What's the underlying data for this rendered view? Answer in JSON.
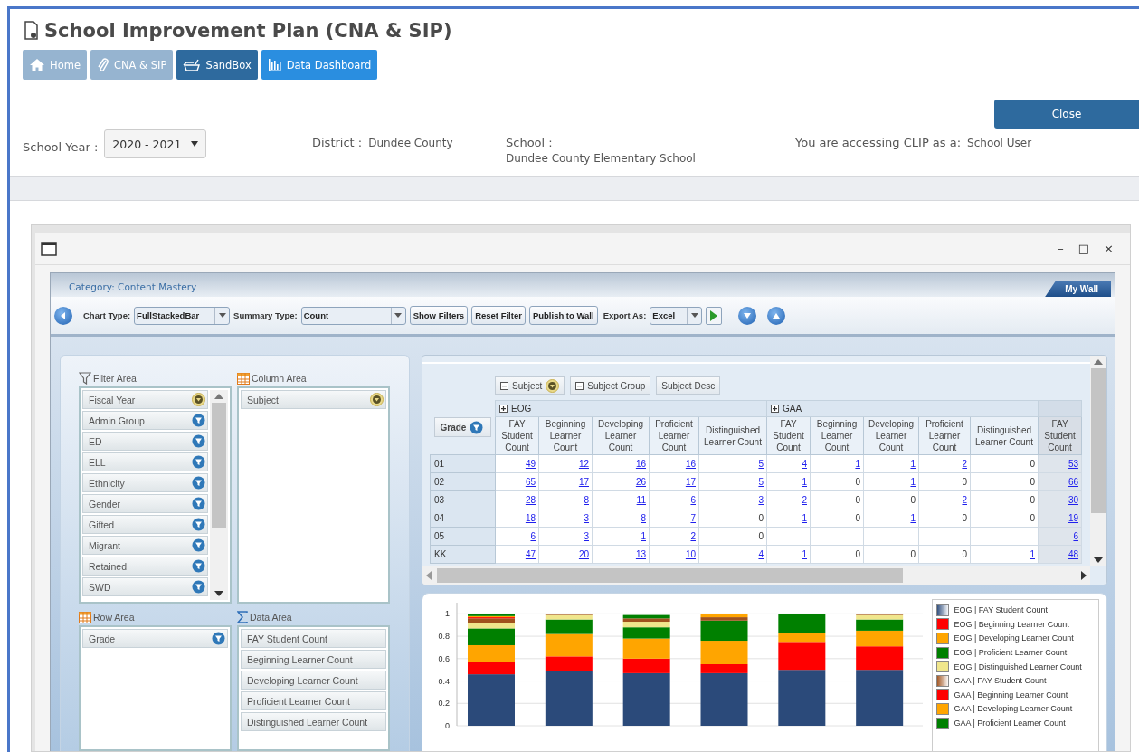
{
  "app_title": "School Improvement Plan (CNA & SIP)",
  "nav": [
    {
      "label": "Home",
      "kind": "muted"
    },
    {
      "label": "CNA & SIP",
      "kind": "muted"
    },
    {
      "label": "SandBox",
      "kind": "dark"
    },
    {
      "label": "Data Dashboard",
      "kind": "active"
    }
  ],
  "close_button": "Close",
  "info": {
    "school_year_label": "School Year :",
    "school_year": "2020 - 2021",
    "district_label": "District :",
    "district": "Dundee County",
    "school_label": "School :",
    "school": "Dundee County Elementary School",
    "access_label": "You are accessing CLIP as a:",
    "access": "School User"
  },
  "window": {
    "controls": [
      "–",
      "□",
      "×"
    ]
  },
  "pivot": {
    "category": "Category: Content Mastery",
    "my_wall": "My Wall",
    "toolbar": {
      "chart_type_label": "Chart Type:",
      "chart_type": "FullStackedBar",
      "summary_type_label": "Summary Type:",
      "summary_type": "Count",
      "buttons": [
        "Show Filters",
        "Reset Filter",
        "Publish to Wall"
      ],
      "export_label": "Export As:",
      "export": "Excel"
    },
    "filter_area": {
      "title": "Filter Area",
      "items": [
        {
          "label": "Fiscal Year",
          "kind": "sort"
        },
        {
          "label": "Admin Group",
          "kind": "filter"
        },
        {
          "label": "ED",
          "kind": "filter"
        },
        {
          "label": "ELL",
          "kind": "filter"
        },
        {
          "label": "Ethnicity",
          "kind": "filter"
        },
        {
          "label": "Gender",
          "kind": "filter"
        },
        {
          "label": "Gifted",
          "kind": "filter"
        },
        {
          "label": "Migrant",
          "kind": "filter"
        },
        {
          "label": "Retained",
          "kind": "filter"
        },
        {
          "label": "SWD",
          "kind": "filter"
        }
      ]
    },
    "column_area": {
      "title": "Column Area",
      "items": [
        {
          "label": "Subject",
          "kind": "sort"
        }
      ]
    },
    "row_area": {
      "title": "Row Area",
      "items": [
        {
          "label": "Grade",
          "kind": "filter"
        }
      ]
    },
    "data_area": {
      "title": "Data Area",
      "items": [
        {
          "label": "FAY Student Count"
        },
        {
          "label": "Beginning Learner Count"
        },
        {
          "label": "Developing Learner Count"
        },
        {
          "label": "Proficient Learner Count"
        },
        {
          "label": "Distinguished Learner Count"
        }
      ]
    },
    "column_fields": [
      {
        "label": "Subject",
        "collapse": true,
        "kind": "sort"
      },
      {
        "label": "Subject Group",
        "collapse": true
      },
      {
        "label": "Subject Desc",
        "collapse": false
      }
    ],
    "row_field": {
      "label": "Grade",
      "kind": "filter"
    },
    "groups": [
      {
        "label": "EOG",
        "kind": "group",
        "columns": [
          "FAY Student Count",
          "Beginning Learner Count",
          "Developing Learner Count",
          "Proficient Learner Count",
          "Distinguished Learner Count"
        ]
      },
      {
        "label": "GAA",
        "kind": "group",
        "columns": [
          "FAY Student Count",
          "Beginning Learner Count",
          "Developing Learner Count",
          "Proficient Learner Count",
          "Distinguished Learner Count"
        ]
      },
      {
        "kind": "total",
        "columns": [
          "FAY Student Count"
        ]
      }
    ],
    "rows": [
      {
        "label": "01",
        "cells": [
          {
            "v": "49",
            "link": true
          },
          {
            "v": "12",
            "link": true
          },
          {
            "v": "16",
            "link": true
          },
          {
            "v": "16",
            "link": true
          },
          {
            "v": "5",
            "link": true
          },
          {
            "v": "4",
            "link": true
          },
          {
            "v": "1",
            "link": true
          },
          {
            "v": "1",
            "link": true
          },
          {
            "v": "2",
            "link": true
          },
          {
            "v": "0",
            "link": false
          },
          {
            "v": "53",
            "link": true
          }
        ]
      },
      {
        "label": "02",
        "cells": [
          {
            "v": "65",
            "link": true
          },
          {
            "v": "17",
            "link": true
          },
          {
            "v": "26",
            "link": true
          },
          {
            "v": "17",
            "link": true
          },
          {
            "v": "5",
            "link": true
          },
          {
            "v": "1",
            "link": true
          },
          {
            "v": "0",
            "link": false
          },
          {
            "v": "1",
            "link": true
          },
          {
            "v": "0",
            "link": false
          },
          {
            "v": "0",
            "link": false
          },
          {
            "v": "66",
            "link": true
          }
        ]
      },
      {
        "label": "03",
        "cells": [
          {
            "v": "28",
            "link": true
          },
          {
            "v": "8",
            "link": true
          },
          {
            "v": "11",
            "link": true
          },
          {
            "v": "6",
            "link": true
          },
          {
            "v": "3",
            "link": true
          },
          {
            "v": "2",
            "link": true
          },
          {
            "v": "0",
            "link": false
          },
          {
            "v": "0",
            "link": false
          },
          {
            "v": "2",
            "link": true
          },
          {
            "v": "0",
            "link": false
          },
          {
            "v": "30",
            "link": true
          }
        ]
      },
      {
        "label": "04",
        "cells": [
          {
            "v": "18",
            "link": true
          },
          {
            "v": "3",
            "link": true
          },
          {
            "v": "8",
            "link": true
          },
          {
            "v": "7",
            "link": true
          },
          {
            "v": "0",
            "link": false
          },
          {
            "v": "1",
            "link": true
          },
          {
            "v": "0",
            "link": false
          },
          {
            "v": "1",
            "link": true
          },
          {
            "v": "0",
            "link": false
          },
          {
            "v": "0",
            "link": false
          },
          {
            "v": "19",
            "link": true
          }
        ]
      },
      {
        "label": "05",
        "cells": [
          {
            "v": "6",
            "link": true
          },
          {
            "v": "3",
            "link": true
          },
          {
            "v": "1",
            "link": true
          },
          {
            "v": "2",
            "link": true
          },
          {
            "v": "0",
            "link": false
          },
          null,
          null,
          null,
          null,
          null,
          {
            "v": "6",
            "link": true
          }
        ]
      },
      {
        "label": "KK",
        "cells": [
          {
            "v": "47",
            "link": true
          },
          {
            "v": "20",
            "link": true
          },
          {
            "v": "13",
            "link": true
          },
          {
            "v": "10",
            "link": true
          },
          {
            "v": "4",
            "link": true
          },
          {
            "v": "1",
            "link": true
          },
          {
            "v": "0",
            "link": false
          },
          {
            "v": "0",
            "link": false
          },
          {
            "v": "0",
            "link": false
          },
          {
            "v": "1",
            "link": true
          },
          {
            "v": "48",
            "link": true
          }
        ]
      }
    ],
    "chart_data": {
      "type": "bar",
      "stacked": true,
      "grid": true,
      "ylim": [
        0,
        1.1
      ],
      "yticks": [
        0,
        0.2,
        0.4,
        0.6,
        0.8,
        1
      ],
      "series": [
        {
          "name": "EOG | FAY Student Count",
          "color": "#2b4a7a",
          "values": [
            0.46,
            0.49,
            0.47,
            0.47,
            0.5,
            0.5
          ]
        },
        {
          "name": "EOG | Beginning Learner Count",
          "color": "#ff0000",
          "values": [
            0.11,
            0.13,
            0.13,
            0.08,
            0.25,
            0.21
          ]
        },
        {
          "name": "EOG | Developing Learner Count",
          "color": "#ffa500",
          "values": [
            0.15,
            0.2,
            0.18,
            0.21,
            0.08,
            0.14
          ]
        },
        {
          "name": "EOG | Proficient Learner Count",
          "color": "#008000",
          "values": [
            0.15,
            0.13,
            0.1,
            0.18,
            0.17,
            0.1
          ]
        },
        {
          "name": "EOG | Distinguished Learner Count",
          "color": "#f0e68c",
          "values": [
            0.05,
            0.04,
            0.05,
            0,
            0,
            0.04
          ]
        },
        {
          "name": "GAA | FAY Student Count",
          "color": "#a0521d",
          "values": [
            0.04,
            0.01,
            0.03,
            0.03,
            0,
            0.01
          ]
        },
        {
          "name": "GAA | Beginning Learner Count",
          "color": "#fe0000",
          "values": [
            0.01,
            0,
            0,
            0,
            0,
            0
          ]
        },
        {
          "name": "GAA | Developing Learner Count",
          "color": "#ffa501",
          "values": [
            0.01,
            0,
            0,
            0.03,
            0,
            0
          ]
        },
        {
          "name": "GAA | Proficient Learner Count",
          "color": "#008001",
          "values": [
            0.02,
            0,
            0.03,
            0,
            0,
            0
          ]
        }
      ]
    }
  }
}
